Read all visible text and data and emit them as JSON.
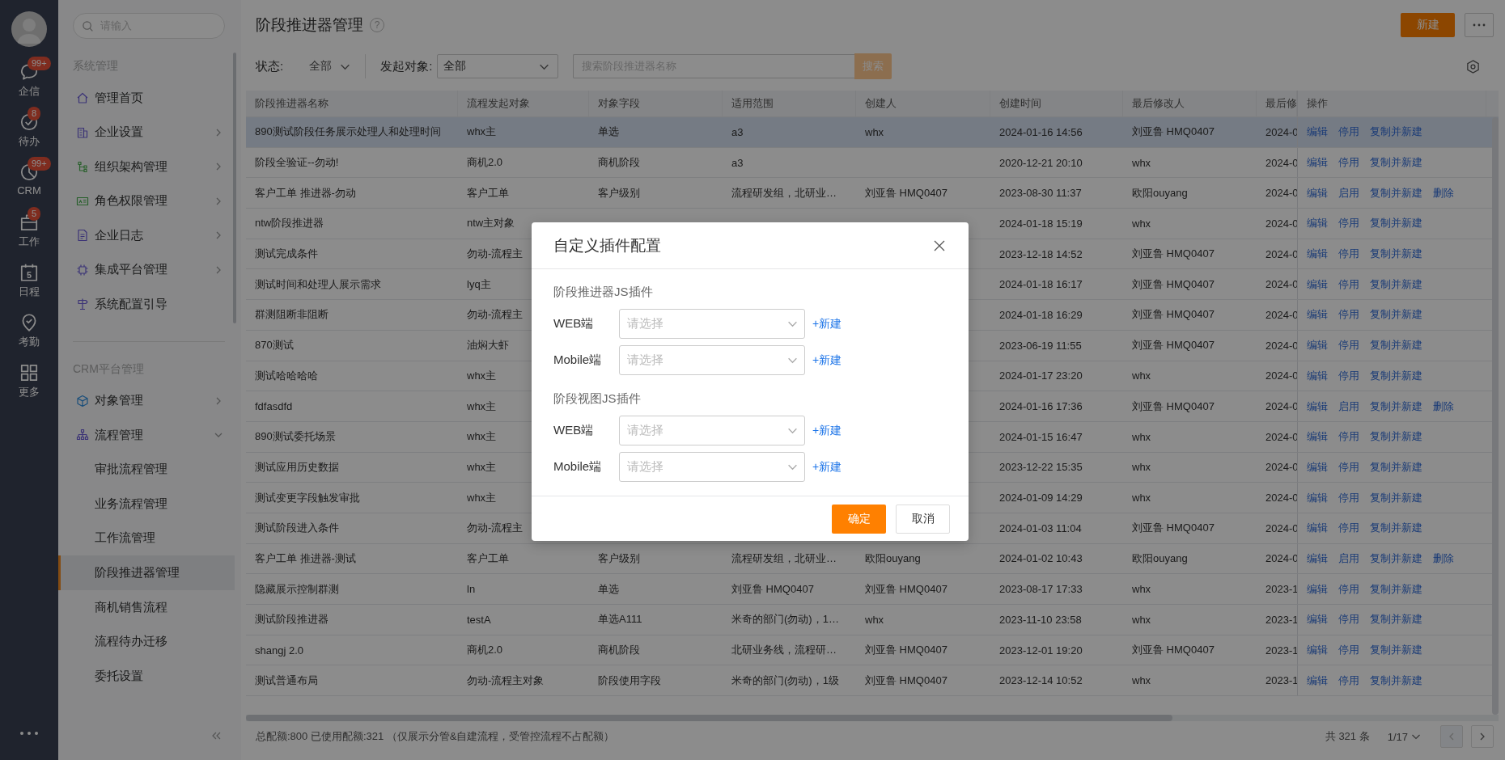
{
  "nav": {
    "items": [
      {
        "label": "企信",
        "badge": "99+"
      },
      {
        "label": "待办",
        "badge": "8"
      },
      {
        "label": "CRM",
        "badge": "99+"
      },
      {
        "label": "工作",
        "badge": "5"
      },
      {
        "label": "日程",
        "date": "5"
      },
      {
        "label": "考勤"
      },
      {
        "label": "更多"
      }
    ]
  },
  "menu": {
    "search": {
      "placeholder": "请输入"
    },
    "groups": [
      {
        "title": "系统管理",
        "items": [
          {
            "label": "管理首页"
          },
          {
            "label": "企业设置",
            "expanded": false
          },
          {
            "label": "组织架构管理",
            "expanded": false
          },
          {
            "label": "角色权限管理",
            "expanded": false
          },
          {
            "label": "企业日志",
            "expanded": false
          },
          {
            "label": "集成平台管理",
            "expanded": false
          },
          {
            "label": "系统配置引导"
          }
        ]
      },
      {
        "title": "CRM平台管理",
        "items": [
          {
            "label": "对象管理",
            "expanded": false
          },
          {
            "label": "流程管理",
            "expanded": true,
            "children": [
              {
                "label": "审批流程管理",
                "selected": false
              },
              {
                "label": "业务流程管理",
                "selected": false
              },
              {
                "label": "工作流管理",
                "selected": false
              },
              {
                "label": "阶段推进器管理",
                "selected": true
              },
              {
                "label": "商机销售流程",
                "selected": false
              },
              {
                "label": "流程待办迁移",
                "selected": false
              },
              {
                "label": "委托设置",
                "selected": false
              }
            ]
          }
        ]
      }
    ]
  },
  "page": {
    "title": "阶段推进器管理",
    "help": "?",
    "new_button": "新建"
  },
  "filters": {
    "status_label": "状态:",
    "status_value": "全部",
    "object_label": "发起对象:",
    "object_value": "全部",
    "search": {
      "placeholder": "搜索阶段推进器名称"
    },
    "search_button": "搜索"
  },
  "table": {
    "columns": [
      "阶段推进器名称",
      "流程发起对象",
      "对象字段",
      "适用范围",
      "创建人",
      "创建时间",
      "最后修改人",
      "最后修",
      "操作"
    ],
    "rows": [
      {
        "selected": true,
        "cells": [
          "890测试阶段任务展示处理人和处理时间",
          "whx主",
          "单选",
          "a3",
          "whx",
          "2024-01-16 14:56",
          "刘亚鲁 HMQ0407",
          "2024-0"
        ],
        "actions": [
          "编辑",
          "停用",
          "复制并新建"
        ]
      },
      {
        "selected": false,
        "cells": [
          "阶段全验证--勿动!",
          "商机2.0",
          "商机阶段",
          "a3",
          null,
          "2020-12-21 20:10",
          "whx",
          "2024-0"
        ],
        "actions": [
          "编辑",
          "停用",
          "复制并新建"
        ]
      },
      {
        "selected": false,
        "cells": [
          "客户工单 推进器-勿动",
          "客户工单",
          "客户级别",
          "流程研发组，北研业…",
          "刘亚鲁 HMQ0407",
          "2023-08-30 11:37",
          "欧阳ouyang",
          "2024-0"
        ],
        "actions": [
          "编辑",
          "启用",
          "复制并新建",
          "删除"
        ]
      },
      {
        "selected": false,
        "cells": [
          "ntw阶段推进器",
          "ntw主对象",
          null,
          null,
          null,
          "2024-01-18 15:19",
          "whx",
          "2024-0"
        ],
        "actions": [
          "编辑",
          "停用",
          "复制并新建"
        ]
      },
      {
        "selected": false,
        "cells": [
          "测试完成条件",
          "勿动-流程主",
          null,
          null,
          null,
          "2023-12-18 14:52",
          "刘亚鲁 HMQ0407",
          "2024-0"
        ],
        "actions": [
          "编辑",
          "停用",
          "复制并新建"
        ]
      },
      {
        "selected": false,
        "cells": [
          "测试时间和处理人展示需求",
          "lyq主",
          null,
          null,
          null,
          "2024-01-18 16:17",
          "刘亚鲁 HMQ0407",
          "2024-0"
        ],
        "actions": [
          "编辑",
          "停用",
          "复制并新建"
        ]
      },
      {
        "selected": false,
        "cells": [
          "群测阻断非阻断",
          "勿动-流程主",
          null,
          null,
          null,
          "2024-01-18 16:29",
          "刘亚鲁 HMQ0407",
          "2024-0"
        ],
        "actions": [
          "编辑",
          "停用",
          "复制并新建"
        ]
      },
      {
        "selected": false,
        "cells": [
          "870测试",
          "油焖大虾",
          null,
          null,
          null,
          "2023-06-19 11:55",
          "刘亚鲁 HMQ0407",
          "2024-0"
        ],
        "actions": [
          "编辑",
          "停用",
          "复制并新建"
        ]
      },
      {
        "selected": false,
        "cells": [
          "测试哈哈哈哈",
          "whx主",
          null,
          null,
          null,
          "2024-01-17 23:20",
          "whx",
          "2024-0"
        ],
        "actions": [
          "编辑",
          "停用",
          "复制并新建"
        ]
      },
      {
        "selected": false,
        "cells": [
          "fdfasdfd",
          "whx主",
          null,
          null,
          null,
          "2024-01-16 17:36",
          "刘亚鲁 HMQ0407",
          "2024-0"
        ],
        "actions": [
          "编辑",
          "启用",
          "复制并新建",
          "删除"
        ]
      },
      {
        "selected": false,
        "cells": [
          "890测试委托场景",
          "whx主",
          null,
          null,
          null,
          "2024-01-15 16:47",
          "whx",
          "2024-0"
        ],
        "actions": [
          "编辑",
          "停用",
          "复制并新建"
        ]
      },
      {
        "selected": false,
        "cells": [
          "测试应用历史数据",
          "whx主",
          null,
          null,
          null,
          "2023-12-22 15:35",
          "whx",
          "2024-0"
        ],
        "actions": [
          "编辑",
          "停用",
          "复制并新建"
        ]
      },
      {
        "selected": false,
        "cells": [
          "测试变更字段触发审批",
          "whx主",
          null,
          null,
          null,
          "2024-01-09 14:29",
          "whx",
          "2024-0"
        ],
        "actions": [
          "编辑",
          "停用",
          "复制并新建"
        ]
      },
      {
        "selected": false,
        "cells": [
          "测试阶段进入条件",
          "勿动-流程主",
          null,
          null,
          null,
          "2024-01-03 11:04",
          "刘亚鲁 HMQ0407",
          "2024-0"
        ],
        "actions": [
          "编辑",
          "停用",
          "复制并新建"
        ]
      },
      {
        "selected": false,
        "cells": [
          "客户工单 推进器-测试",
          "客户工单",
          "客户级别",
          "流程研发组，北研业…",
          "欧阳ouyang",
          "2024-01-02 10:43",
          "欧阳ouyang",
          "2024-0"
        ],
        "actions": [
          "编辑",
          "启用",
          "复制并新建",
          "删除"
        ]
      },
      {
        "selected": false,
        "cells": [
          "隐藏展示控制群测",
          "ln",
          "单选",
          "刘亚鲁 HMQ0407",
          "刘亚鲁 HMQ0407",
          "2023-08-17 17:33",
          "whx",
          "2023-1"
        ],
        "actions": [
          "编辑",
          "停用",
          "复制并新建"
        ]
      },
      {
        "selected": false,
        "cells": [
          "测试阶段推进器",
          "testA",
          "单选A111",
          "米奇的部门(勿动)，1…",
          "whx",
          "2023-11-10 23:58",
          "whx",
          "2023-1"
        ],
        "actions": [
          "编辑",
          "停用",
          "复制并新建"
        ]
      },
      {
        "selected": false,
        "cells": [
          "shangj 2.0",
          "商机2.0",
          "商机阶段",
          "北研业务线，流程研…",
          "刘亚鲁 HMQ0407",
          "2023-12-01 19:20",
          "刘亚鲁 HMQ0407",
          "2023-1"
        ],
        "actions": [
          "编辑",
          "停用",
          "复制并新建"
        ]
      },
      {
        "selected": false,
        "cells": [
          "测试普通布局",
          "勿动-流程主对象",
          "阶段使用字段",
          "米奇的部门(勿动)，1级",
          "刘亚鲁 HMQ0407",
          "2023-12-14 10:52",
          "whx",
          "2023-1"
        ],
        "actions": [
          "编辑",
          "停用",
          "复制并新建"
        ]
      }
    ]
  },
  "footer": {
    "quota": "总配额:800 已使用配额:321 （仅展示分管&自建流程，受管控流程不占配额）",
    "total": "共 321 条",
    "page": "1/17"
  },
  "dialog": {
    "title": "自定义插件配置",
    "sections": [
      {
        "title": "阶段推进器JS插件",
        "rows": [
          {
            "label": "WEB端",
            "placeholder": "请选择",
            "link": "+新建"
          },
          {
            "label": "Mobile端",
            "placeholder": "请选择",
            "link": "+新建"
          }
        ]
      },
      {
        "title": "阶段视图JS插件",
        "rows": [
          {
            "label": "WEB端",
            "placeholder": "请选择",
            "link": "+新建"
          },
          {
            "label": "Mobile端",
            "placeholder": "请选择",
            "link": "+新建"
          }
        ]
      }
    ],
    "ok": "确定",
    "cancel": "取消"
  }
}
